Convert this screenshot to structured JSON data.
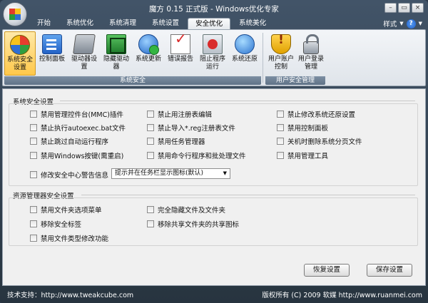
{
  "window": {
    "title": "魔方 0.15 正式版 - Windows优化专家"
  },
  "window_buttons": {
    "minimize": "–",
    "restore": "▭",
    "close": "×"
  },
  "tabs": [
    {
      "label": "开始",
      "active": false
    },
    {
      "label": "系统优化",
      "active": false
    },
    {
      "label": "系统清理",
      "active": false
    },
    {
      "label": "系统设置",
      "active": false
    },
    {
      "label": "安全优化",
      "active": true
    },
    {
      "label": "系统美化",
      "active": false
    }
  ],
  "style_menu": {
    "label": "样式",
    "help": "?"
  },
  "ribbon": {
    "security_group": {
      "label": "系统安全",
      "buttons": [
        {
          "label": "系统安全设置",
          "icon": "windows-globe-icon",
          "active": true
        },
        {
          "label": "控制面板",
          "icon": "control-panel-icon"
        },
        {
          "label": "驱动器设置",
          "icon": "drive-icon"
        },
        {
          "label": "隐藏驱动器",
          "icon": "hidden-drive-icon"
        },
        {
          "label": "系统更新",
          "icon": "update-icon"
        },
        {
          "label": "错误报告",
          "icon": "error-report-icon"
        },
        {
          "label": "阻止程序运行",
          "icon": "block-program-icon"
        },
        {
          "label": "系统还原",
          "icon": "system-restore-icon"
        }
      ]
    },
    "user_group": {
      "label": "用户安全管理",
      "buttons": [
        {
          "label": "用户账户控制",
          "icon": "uac-shield-icon"
        },
        {
          "label": "用户登录管理",
          "icon": "login-lock-icon"
        }
      ]
    }
  },
  "system_security": {
    "title": "系统安全设置",
    "options": [
      "禁用管理控件台(MMC)插件",
      "禁止用注册表编辑",
      "禁止修改系统还原设置",
      "禁止执行autoexec.bat文件",
      "禁止导入*.reg注册表文件",
      "禁用控制面板",
      "禁止跳过自动运行程序",
      "禁用任务管理器",
      "关机时删除系统分页文件",
      "禁用Windows按键(需重启)",
      "禁用命令行程序和批处理文件",
      "禁用管理工具"
    ],
    "warning_option": "修改安全中心警告信息",
    "warning_select": "提示并在任务栏显示图标(默认)"
  },
  "explorer_security": {
    "title": "资源管理器安全设置",
    "options": [
      "禁用文件夹选项菜单",
      "完全隐藏文件及文件夹",
      "移除安全标签",
      "移除共享文件夹的共享图标",
      "禁用文件类型修改功能"
    ]
  },
  "buttons": {
    "restore": "恢复设置",
    "save": "保存设置"
  },
  "status": {
    "left": "技术支持：http://www.tweakcube.com",
    "right": "版权所有 (C) 2009 软媒 http://www.ruanmei.com"
  }
}
